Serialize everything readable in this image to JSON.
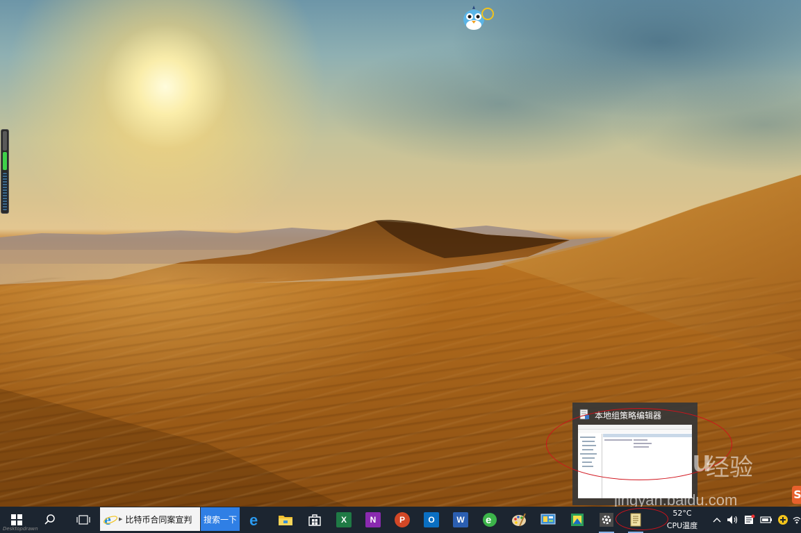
{
  "window_thumbnail": {
    "title": "本地组策略编辑器"
  },
  "search": {
    "text": "比特币合同案宣判",
    "button_label": "搜索一下"
  },
  "taskbar": {
    "apps": [
      {
        "id": "edge",
        "icon": "edge-icon",
        "label": "e",
        "color": "#1e8fe0"
      },
      {
        "id": "file-explorer",
        "icon": "folder-icon",
        "label": "",
        "color": "#f2c030"
      },
      {
        "id": "store",
        "icon": "store-icon",
        "label": "",
        "color": "#ffffff"
      },
      {
        "id": "excel",
        "icon": "excel-icon",
        "label": "X",
        "color": "#1f7a45"
      },
      {
        "id": "onenote",
        "icon": "onenote-icon",
        "label": "N",
        "color": "#8a2ab0"
      },
      {
        "id": "powerpoint",
        "icon": "powerpoint-icon",
        "label": "P",
        "color": "#d24726"
      },
      {
        "id": "outlook",
        "icon": "outlook-icon",
        "label": "O",
        "color": "#0a6fc2"
      },
      {
        "id": "word",
        "icon": "word-icon",
        "label": "W",
        "color": "#2b5fb2"
      },
      {
        "id": "browser-360",
        "icon": "browser-360-icon",
        "label": "e",
        "color": "#3cb44a"
      },
      {
        "id": "paint",
        "icon": "paint-palette-icon",
        "label": "",
        "color": "#c9a060"
      },
      {
        "id": "control-panel",
        "icon": "control-panel-icon",
        "label": "",
        "color": "#3a8fd4"
      },
      {
        "id": "photo-app",
        "icon": "photo-app-icon",
        "label": "",
        "color": "#2a9d5a"
      },
      {
        "id": "settings",
        "icon": "gear-icon",
        "label": "",
        "color": "#4a4a4a"
      },
      {
        "id": "group-policy",
        "icon": "policy-scroll-icon",
        "label": "",
        "color": "#f0e2a8"
      }
    ]
  },
  "cpu_monitor": {
    "temperature": "52°C",
    "label": "CPU温度"
  },
  "watermark": {
    "logo": "Bai du",
    "subtitle": "经验",
    "url": "jingyan.baidu.com"
  },
  "desktop_label": "Desktopdrawn"
}
